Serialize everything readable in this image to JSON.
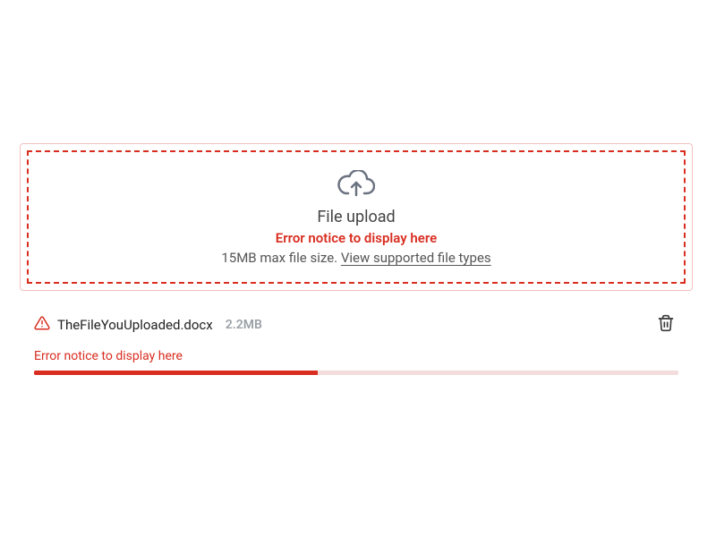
{
  "dropzone": {
    "title": "File upload",
    "error": "Error notice to display here",
    "hint_prefix": "15MB max file size. ",
    "hint_link": "View supported file types",
    "icon": "cloud-upload-icon"
  },
  "file": {
    "name": "TheFileYouUploaded.docx",
    "size": "2.2MB",
    "error": "Error notice to display here",
    "progress_percent": 44,
    "warn_icon": "alert-triangle-icon",
    "delete_icon": "trash-icon"
  },
  "colors": {
    "error": "#d92d20"
  }
}
